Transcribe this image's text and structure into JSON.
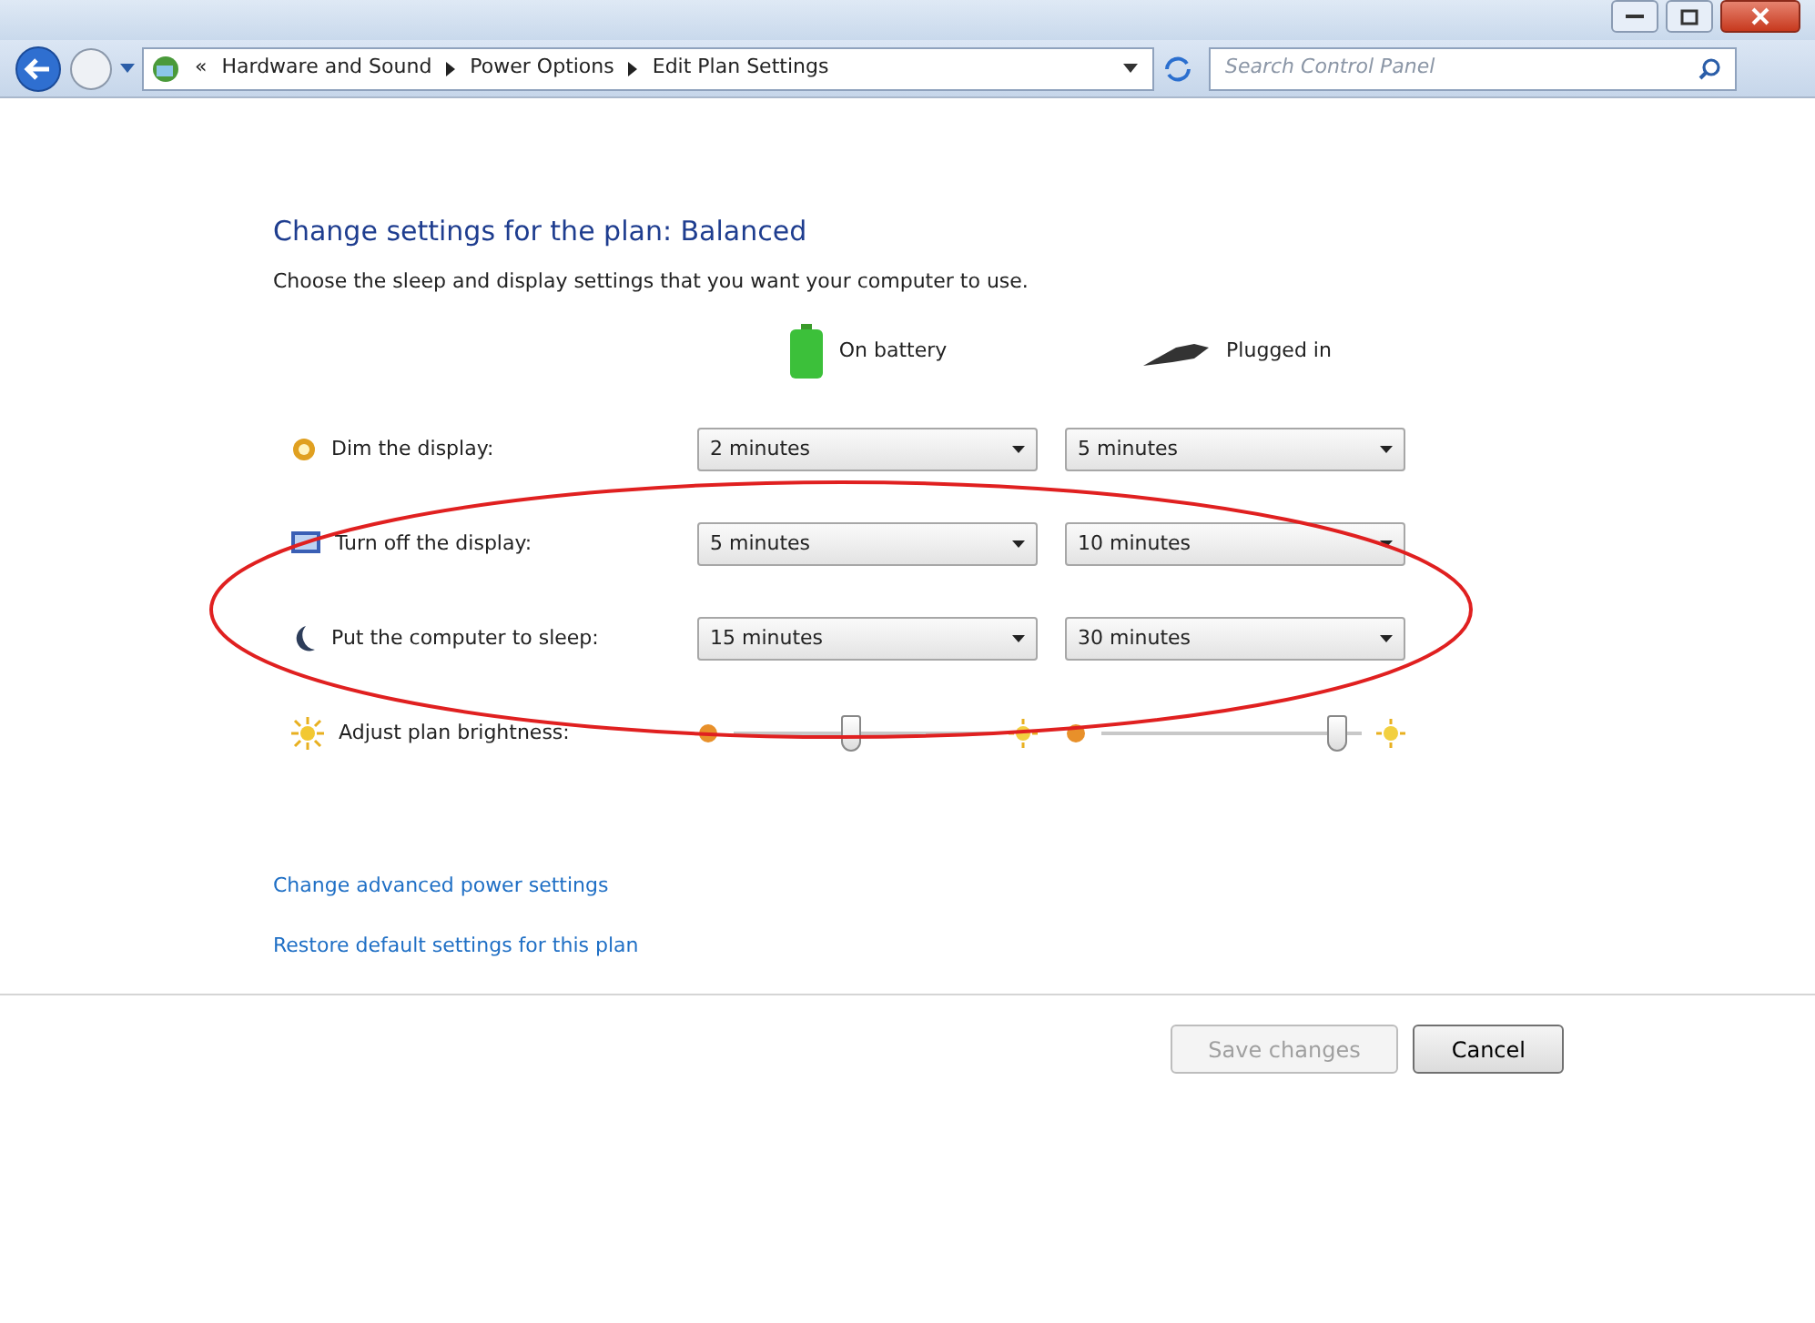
{
  "address_bar": {
    "overflow": "«",
    "breadcrumbs": [
      "Hardware and Sound",
      "Power Options",
      "Edit Plan Settings"
    ]
  },
  "search": {
    "placeholder": "Search Control Panel"
  },
  "heading": "Change settings for the plan: Balanced",
  "description": "Choose the sleep and display settings that you want your computer to use.",
  "columns": [
    {
      "label": "On battery"
    },
    {
      "label": "Plugged in"
    }
  ],
  "settings": [
    {
      "kind": "select",
      "label": "Dim the display:",
      "values": [
        "2 minutes",
        "5 minutes"
      ]
    },
    {
      "kind": "select",
      "label": "Turn off the display:",
      "values": [
        "5 minutes",
        "10 minutes"
      ]
    },
    {
      "kind": "select",
      "label": "Put the computer to sleep:",
      "values": [
        "15 minutes",
        "30 minutes"
      ]
    },
    {
      "kind": "slider",
      "label": "Adjust plan brightness:",
      "sliders": [
        {
          "level": 0.45
        },
        {
          "level": 0.9
        }
      ]
    }
  ],
  "links": [
    "Change advanced power settings",
    "Restore default settings for this plan"
  ],
  "buttons": [
    {
      "label": "Save changes",
      "disabled": true
    },
    {
      "label": "Cancel",
      "disabled": false
    }
  ]
}
